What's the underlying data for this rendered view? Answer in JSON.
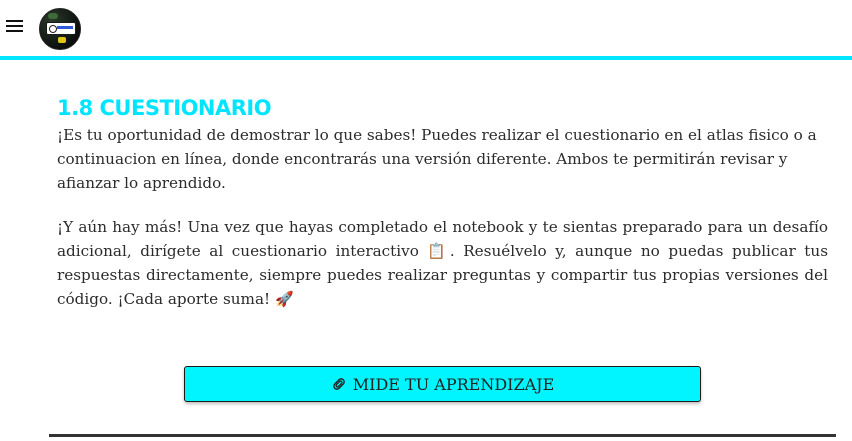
{
  "header": {
    "menu_icon": "hamburger-menu-icon",
    "logo_icon": "site-logo-icon",
    "accent_color": "#00e5ff"
  },
  "section": {
    "title": "1.8 CUESTIONARIO",
    "paragraph1": "¡Es tu oportunidad de demostrar lo que sabes! Puedes realizar el cuestionario en el atlas fisico o a continuacion en línea, donde encontrarás una versión diferente. Ambos te permitirán revisar y afianzar lo aprendido.",
    "paragraph2_part1": "¡Y aún hay más! Una vez que hayas completado el notebook y te sientas preparado para un desafío adicional, dirígete al cuestionario interactivo ",
    "paragraph2_emoji1": "📋",
    "paragraph2_part2": ". Resuélvelo y, aunque no puedas publicar tus respuestas directamente, siempre puedes realizar preguntas y compartir tus propias versiones del código. ¡Cada aporte suma! ",
    "paragraph2_emoji2": "🚀"
  },
  "cta_button": {
    "icon": "✎",
    "icon_name": "paperclip-icon",
    "label": "MIDE TU APRENDIZAJE",
    "background": "#00f5ff"
  }
}
